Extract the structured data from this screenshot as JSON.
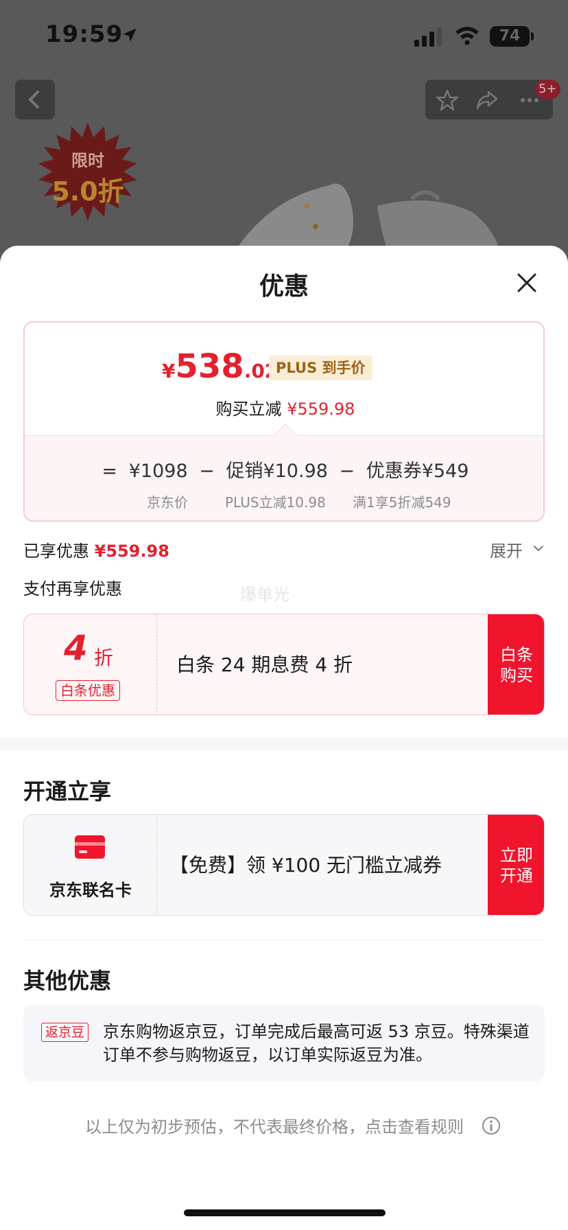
{
  "status_bar": {
    "time": "19:59",
    "battery": "74"
  },
  "background": {
    "badge": "5+",
    "promo_line1": "限时",
    "promo_line2": "5.0折"
  },
  "sheet": {
    "title": "优惠",
    "price": {
      "currency": "¥",
      "integer": "538",
      "decimal": ".02",
      "plus_tag": "PLUS 到手价",
      "reduce_label": "购买立减",
      "reduce_value": "¥559.98",
      "formula": {
        "equals": "=",
        "jd_price": "¥1098",
        "minus1": "−",
        "promo": "促销¥10.98",
        "minus2": "−",
        "coupon": "优惠券¥549",
        "jd_price_label": "京东价",
        "promo_label": "PLUS立减10.98",
        "coupon_label": "满1享5折减549"
      }
    },
    "enjoyed": {
      "label": "已享优惠",
      "value": "¥559.98",
      "expand": "展开"
    },
    "pay_title": "支付再享优惠",
    "watermark": "爆单光",
    "baitiao": {
      "discount": "4",
      "unit": "折",
      "tag": "白条优惠",
      "desc": "白条 24 期息费 4 折",
      "button_line1": "白条",
      "button_line2": "购买"
    },
    "open_section": {
      "title": "开通立享",
      "card_name": "京东联名卡",
      "desc": "【免费】领 ¥100 无门槛立减券",
      "button_line1": "立即",
      "button_line2": "开通"
    },
    "other_section": {
      "title": "其他优惠",
      "tag": "返京豆",
      "text": "京东购物返京豆，订单完成后最高可返 53 京豆。特殊渠道订单不参与购物返豆，以订单实际返豆为准。"
    },
    "disclaimer": "以上仅为初步预估，不代表最终价格，点击查看规则"
  },
  "colors": {
    "accent_red": "#e4202f",
    "button_red": "#f0142d",
    "plus_gold": "#9a6415"
  }
}
